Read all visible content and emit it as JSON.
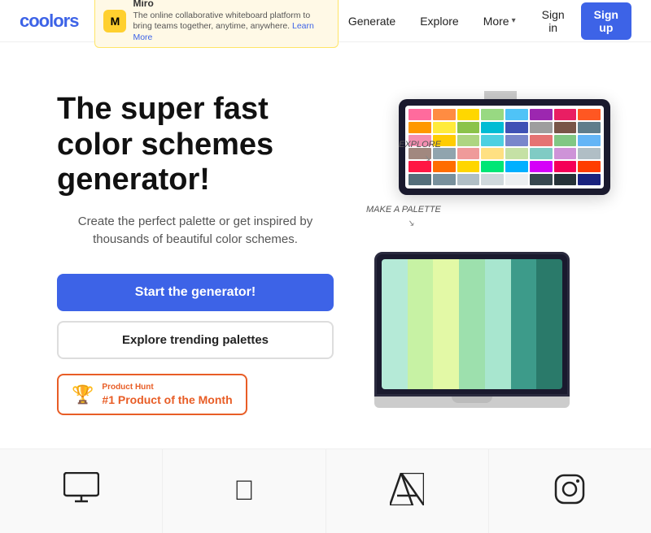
{
  "nav": {
    "logo": "coolors",
    "miro": {
      "name": "Miro",
      "tagline": "The online collaborative whiteboard platform to bring teams together, anytime, anywhere.",
      "learn_more": "Learn More"
    },
    "links": [
      "Generate",
      "Explore"
    ],
    "more_label": "More",
    "signin_label": "Sign in",
    "signup_label": "Sign up"
  },
  "hero": {
    "title": "The super fast color schemes generator!",
    "subtitle": "Create the perfect palette or get inspired by thousands of beautiful color schemes.",
    "cta_primary": "Start the generator!",
    "cta_secondary": "Explore trending palettes",
    "product_hunt": {
      "label": "Product Hunt",
      "rank": "#1 Product of the Month"
    },
    "annotation_explore": "EXPLORE",
    "annotation_palette": "MAKE A PALETTE"
  },
  "palette_colors": [
    "#b5ead7",
    "#c7f2a4",
    "#e3f9a6",
    "#9de0ad",
    "#a8e6cf",
    "#3d9b8a",
    "#2a7a6a"
  ],
  "monitor_colors": [
    "#ff6b9d",
    "#ff8c42",
    "#ffd700",
    "#98d982",
    "#4fc3f7",
    "#9c27b0",
    "#e91e63",
    "#ff5722",
    "#ff9800",
    "#ffeb3b",
    "#8bc34a",
    "#00bcd4",
    "#3f51b5",
    "#9e9e9e",
    "#795548",
    "#607d8b",
    "#f48fb1",
    "#ffcc02",
    "#aed581",
    "#4dd0e1",
    "#7986cb",
    "#e57373",
    "#81c784",
    "#64b5f6",
    "#a1887f",
    "#90a4ae",
    "#ef9a9a",
    "#ffe082",
    "#c5e1a5",
    "#80cbc4",
    "#ce93d8",
    "#b0bec5",
    "#ff1744",
    "#ff6d00",
    "#ffd600",
    "#00e676",
    "#00b0ff",
    "#d500f9",
    "#f50057",
    "#ff3d00",
    "#546e7a",
    "#78909c",
    "#b0bec5",
    "#cfd8dc",
    "#eceff1",
    "#37474f",
    "#263238",
    "#1a237e"
  ],
  "logos": [
    {
      "name": "monitor",
      "symbol": "🖥"
    },
    {
      "name": "apple",
      "symbol": ""
    },
    {
      "name": "adobe",
      "symbol": "A"
    },
    {
      "name": "instagram",
      "symbol": "◻"
    }
  ]
}
